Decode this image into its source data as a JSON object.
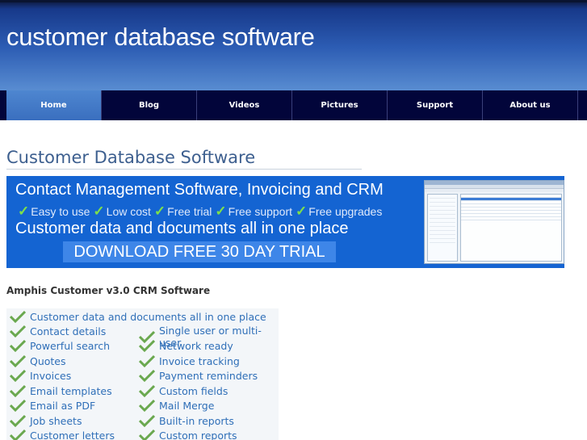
{
  "site": {
    "title": "customer database software"
  },
  "nav": {
    "items": [
      {
        "label": "Home",
        "active": true
      },
      {
        "label": "Blog",
        "active": false
      },
      {
        "label": "Videos",
        "active": false
      },
      {
        "label": "Pictures",
        "active": false
      },
      {
        "label": "Support",
        "active": false
      },
      {
        "label": "About us",
        "active": false
      }
    ]
  },
  "main": {
    "heading": "Customer Database Software",
    "banner": {
      "line1": "Contact Management Software, Invoicing and CRM",
      "checks": [
        "Easy to use",
        "Low cost",
        "Free trial",
        "Free support",
        "Free upgrades"
      ],
      "line3": "Customer data and documents all in one place",
      "download": "DOWNLOAD FREE 30 DAY TRIAL"
    },
    "product_heading": "Amphis Customer v3.0 CRM Software",
    "features_left": [
      "Customer data and documents all in one place",
      "Contact details",
      "Powerful search",
      "Quotes",
      "Invoices",
      "Email templates",
      "Email as PDF",
      "Job sheets",
      "Customer letters"
    ],
    "features_right": [
      "Single user or multi-user",
      "Network ready",
      "Invoice tracking",
      "Payment reminders",
      "Custom fields",
      "Mail Merge",
      "Built-in reports",
      "Custom reports"
    ]
  },
  "colors": {
    "nav_bg": "#02053a",
    "nav_active": "#4e86d0",
    "banner_bg": "#1464d2",
    "feature_text": "#2f6fb8",
    "tick_green": "#6aa84f"
  },
  "icons": {
    "check": "check-icon"
  }
}
